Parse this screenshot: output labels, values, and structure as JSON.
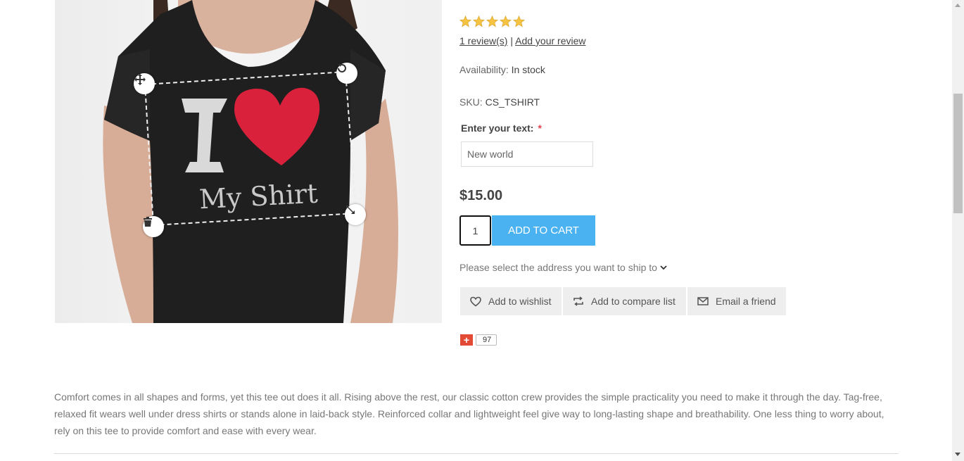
{
  "product": {
    "image_alt": "I ♥ My Shirt",
    "shirt_text": "My Shirt",
    "shirt_letter": "I",
    "rating_stars": 5,
    "reviews_link": "1 review(s)",
    "reviews_separator": "|",
    "add_review_link": "Add your review",
    "availability_label": "Availability:",
    "availability_value": "In stock",
    "sku_label": "SKU:",
    "sku_value": "CS_TSHIRT",
    "text_attribute_label": "Enter your text:",
    "required_mark": "*",
    "text_attribute_value": "New world",
    "price": "$15.00",
    "quantity": "1",
    "add_to_cart_label": "ADD TO CART",
    "ship_to_label": "Please select the address you want to ship to",
    "actions": {
      "wishlist_label": "Add to wishlist",
      "compare_label": "Add to compare list",
      "email_label": "Email a friend"
    },
    "share": {
      "plus_label": "+",
      "count": "97"
    },
    "description": "Comfort comes in all shapes and forms, yet this tee out does it all. Rising above the rest, our classic cotton crew provides the simple practicality you need to make it through the day. Tag-free, relaxed fit wears well under dress shirts or stands alone in laid-back style. Reinforced collar and lightweight feel give way to long-lasting shape and breathability. One less thing to worry about, rely on this tee to provide comfort and ease with every wear."
  },
  "icons": {
    "star": "star-icon",
    "heart": "heart-icon",
    "compare": "compare-icon",
    "email": "envelope-icon",
    "chevron": "chevron-down-icon",
    "move": "move-icon",
    "rotate": "rotate-icon",
    "delete": "trash-icon",
    "resize": "resize-icon"
  },
  "colors": {
    "accent": "#4ab2f1",
    "star": "#f5c242",
    "heart": "#d9213b",
    "required": "#e4444c",
    "share": "#e34a36"
  }
}
